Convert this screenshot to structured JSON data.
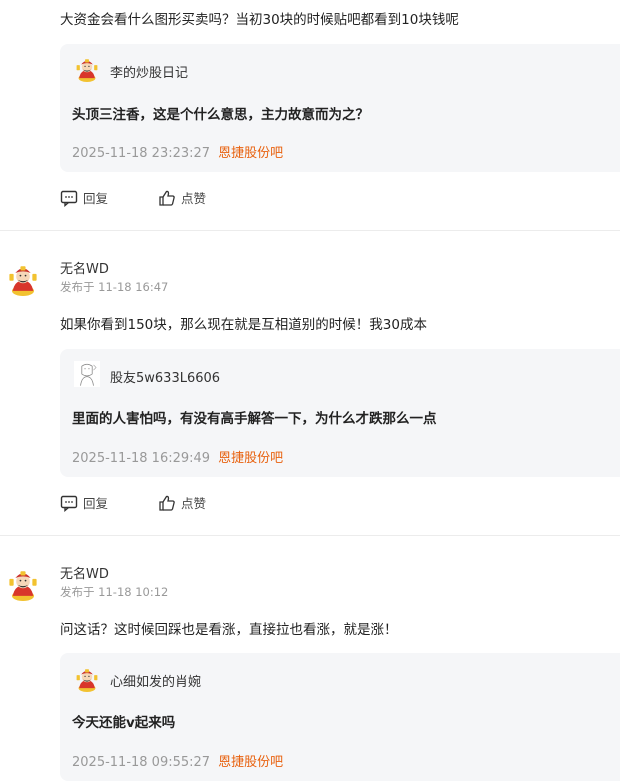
{
  "comments": [
    {
      "text": "大资金会看什么图形买卖吗？当初30块的时候贴吧都看到10块钱呢",
      "quote": {
        "author": "李的炒股日记",
        "text": "头顶三注香，这是个什么意思，主力故意而为之？",
        "time": "2025-11-18 23:23:27",
        "bar": "恩捷股份吧"
      },
      "reply_label": "回复",
      "like_label": "点赞"
    },
    {
      "author": "无名WD",
      "published": "发布于 11-18 16:47",
      "text": "如果你看到150块，那么现在就是互相道别的时候！我30成本",
      "quote": {
        "author": "股友5w633L6606",
        "text": "里面的人害怕吗，有没有高手解答一下，为什么才跌那么一点",
        "time": "2025-11-18 16:29:49",
        "bar": "恩捷股份吧"
      },
      "reply_label": "回复",
      "like_label": "点赞"
    },
    {
      "author": "无名WD",
      "published": "发布于 11-18 10:12",
      "text": "问这话？这时候回踩也是看涨，直接拉也看涨，就是涨！",
      "quote": {
        "author": "心细如发的肖婉",
        "text": "今天还能v起来吗",
        "time": "2025-11-18 09:55:27",
        "bar": "恩捷股份吧"
      }
    }
  ],
  "colors": {
    "accent": "#e8620f",
    "quote_bg": "#f5f6f8",
    "meta": "#999999"
  }
}
